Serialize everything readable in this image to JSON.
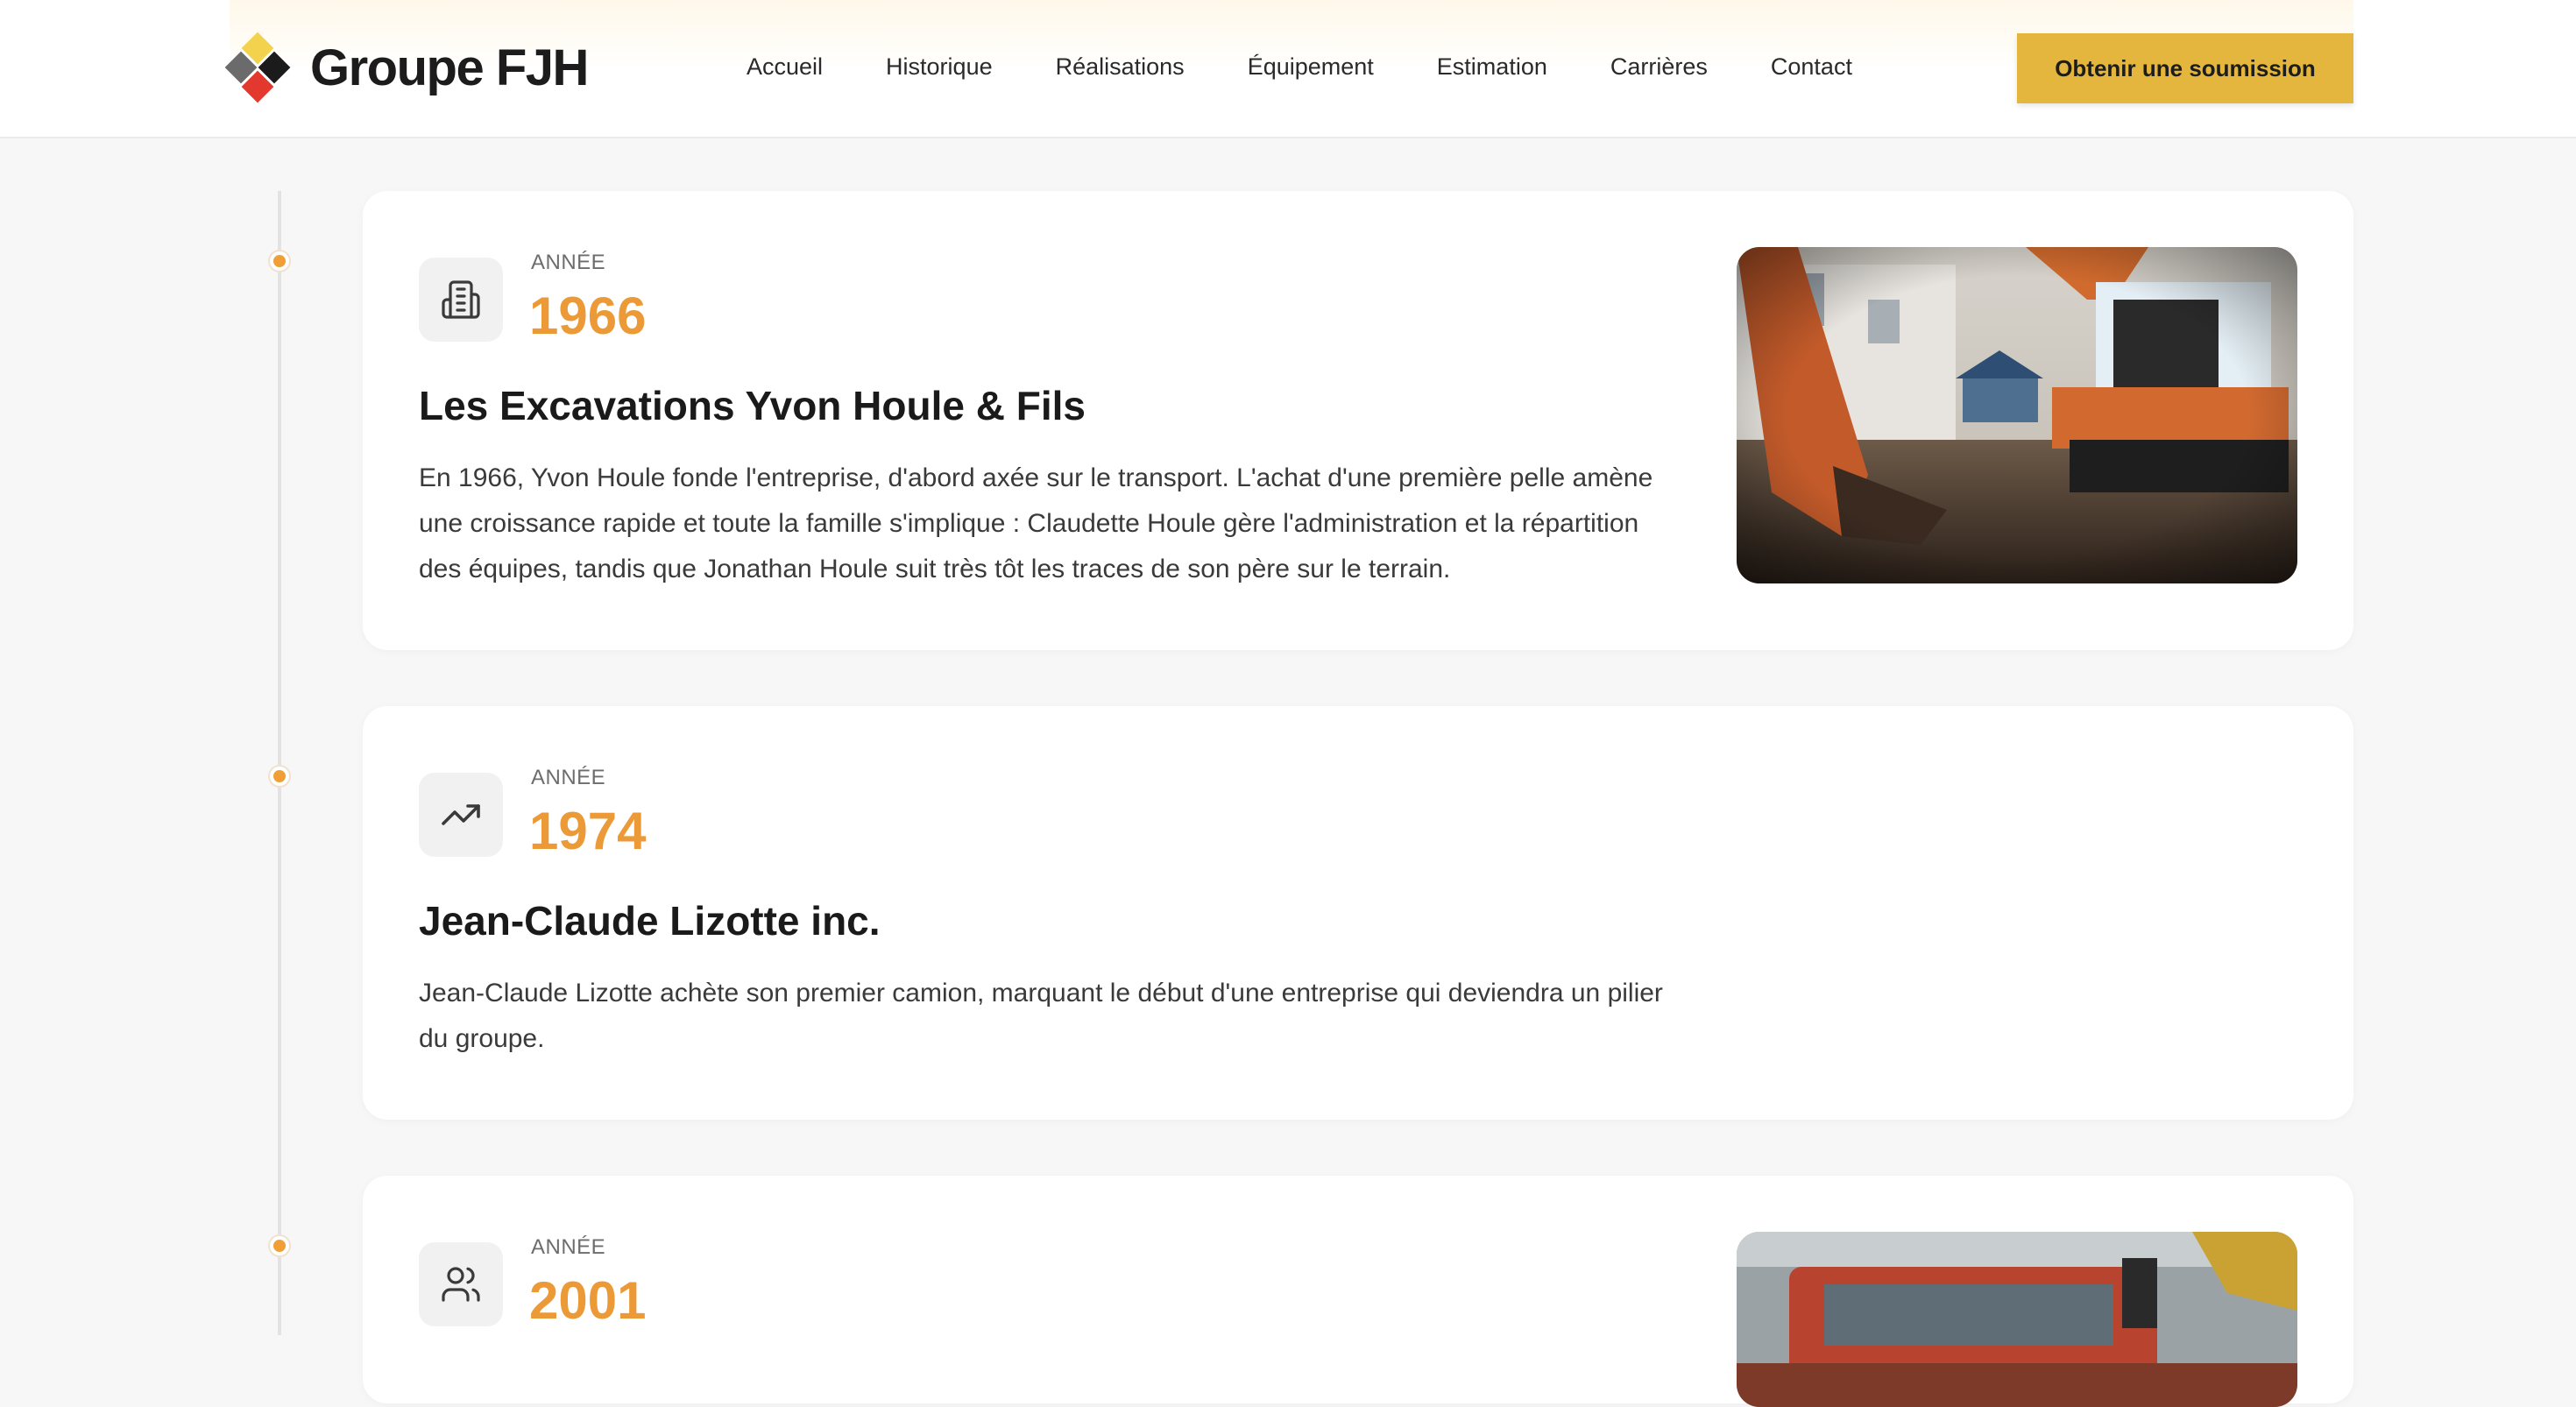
{
  "brand": {
    "name": "Groupe FJH"
  },
  "nav": {
    "items": [
      "Accueil",
      "Historique",
      "Réalisations",
      "Équipement",
      "Estimation",
      "Carrières",
      "Contact"
    ]
  },
  "cta": {
    "label": "Obtenir une soumission"
  },
  "colors": {
    "accent": "#eb9a37",
    "cta": "#e4b63d",
    "logo_yellow": "#f3d24e",
    "logo_red": "#e2382e"
  },
  "timeline": [
    {
      "icon": "building-icon",
      "year_label": "ANNÉE",
      "year": "1966",
      "title": "Les Excavations Yvon Houle & Fils",
      "description": "En 1966, Yvon Houle fonde l'entreprise, d'abord axée sur le transport. L'achat d'une première pelle amène une croissance rapide et toute la famille s'implique : Claudette Houle gère l'administration et la répartition des équipes, tandis que Jonathan Houle suit très tôt les traces de son père sur le terrain."
    },
    {
      "icon": "trending-up-icon",
      "year_label": "ANNÉE",
      "year": "1974",
      "title": "Jean-Claude Lizotte inc.",
      "description": "Jean-Claude Lizotte achète son premier camion, marquant le début d'une entreprise qui deviendra un pilier du groupe."
    },
    {
      "icon": "users-icon",
      "year_label": "ANNÉE",
      "year": "2001"
    }
  ]
}
